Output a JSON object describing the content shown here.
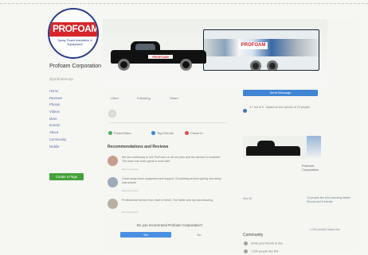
{
  "sidebar": {
    "logo_text": "PROFOAM",
    "logo_subtext": "Spray Foam Insulation & Equipment",
    "page_name": "Profoam Corporation",
    "handle": "@profoamcorp",
    "nav": [
      "Home",
      "Reviews",
      "Photos",
      "Videos",
      "More",
      "Events",
      "About",
      "Community",
      "Mobile"
    ],
    "promote_label": "Create a Page"
  },
  "cover": {
    "trailer_logo": "PROFOAM",
    "truck_decal": "PROFOAM"
  },
  "actions": {
    "like": "Liked",
    "following": "Following",
    "share": "Share"
  },
  "composer": {
    "photo": "Photo/Video",
    "tag": "Tag Friends",
    "check": "Check in"
  },
  "recommendations": {
    "title": "Recommendations and Reviews",
    "reviews": [
      {
        "text": "We are continuing to use ProFoam on all our jobs and the service is excellent. The team has been great to work with.",
        "meta": "Recommended"
      },
      {
        "text": "Great spray foam equipment and support. Everything arrived quickly and setup was simple.",
        "meta": "Recommended"
      },
      {
        "text": "Professional service from start to finish. The trailer and rig look amazing.",
        "meta": "Recommended"
      }
    ],
    "prompt": "Do you recommend Profoam Corporation?",
    "yes_label": "Yes",
    "no_label": "No"
  },
  "right": {
    "send_label": "Send Message",
    "response_text": "4.7 out of 5 · Based on the opinion of 23 people",
    "small_tag": "Profoam Corporation",
    "see_all": "See All",
    "note": "14 people like this including Martin Stroud and 6 friends",
    "note2": "1,234 people follow this",
    "community_title": "Community",
    "community": [
      "Invite your friends to like",
      "1,234 people like this"
    ]
  }
}
